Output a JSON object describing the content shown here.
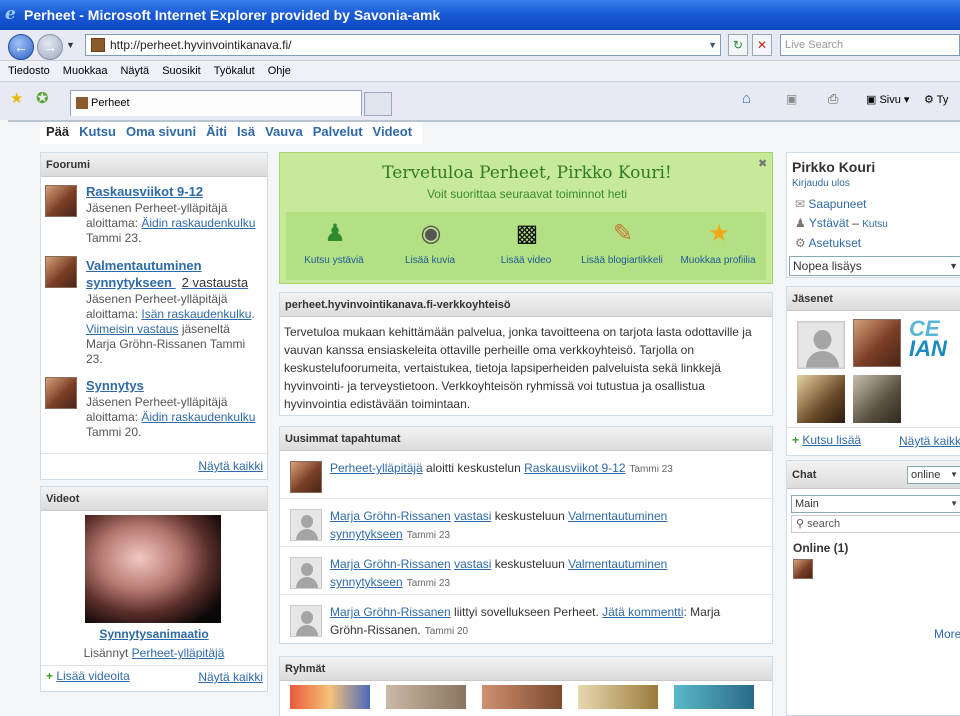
{
  "window": {
    "title": "Perheet - Microsoft Internet Explorer provided by Savonia-amk",
    "address": "http://perheet.hyvinvointikanava.fi/",
    "search_placeholder": "Live Search",
    "menu": [
      "Tiedosto",
      "Muokkaa",
      "Näytä",
      "Suosikit",
      "Työkalut",
      "Ohje"
    ],
    "tab_title": "Perheet",
    "sivu_label": "Sivu",
    "tyo_label": "Ty"
  },
  "nav": [
    "Pää",
    "Kutsu",
    "Oma sivuni",
    "Äiti",
    "Isä",
    "Vauva",
    "Palvelut",
    "Videot"
  ],
  "forum": {
    "heading": "Foorumi",
    "items": [
      {
        "title": "Raskausviikot 9-12",
        "line1": "Jäsenen Perheet-ylläpitäjä",
        "starter_prefix": "aloittama: ",
        "starter_link": "Äidin raskaudenkulku",
        "date": "Tammi 23."
      },
      {
        "title": "Valmentautuminen synnytykseen",
        "title_1": "Valmentautuminen",
        "title_2": "synnytykseen",
        "reply_count": "2 vastausta",
        "line1": "Jäsenen Perheet-ylläpitäjä",
        "starter_prefix": "aloittama: ",
        "starter_link": "Isän raskaudenkulku",
        "latest_link": "Viimeisin vastaus",
        "latest_suffix": " jäseneltä",
        "latest_name": "Marja Gröhn-Rissanen Tammi",
        "date": "23."
      },
      {
        "title": "Synnytys",
        "line1": "Jäsenen Perheet-ylläpitäjä",
        "starter_prefix": "aloittama: ",
        "starter_link": "Äidin raskaudenkulku",
        "date": "Tammi 20."
      }
    ],
    "show_all": "Näytä kaikki"
  },
  "videos": {
    "heading": "Videot",
    "title": "Synnytysanimaatio",
    "added_prefix": "Lisännyt ",
    "added_by": "Perheet-ylläpitäjä",
    "add": "Lisää videoita",
    "show_all": "Näytä kaikki"
  },
  "welcome": {
    "title": "Tervetuloa Perheet, Pirkko Kouri!",
    "subtitle": "Voit suorittaa seuraavat toiminnot heti",
    "actions": [
      {
        "label": "Kutsu ystäviä",
        "icon": "add-user-icon"
      },
      {
        "label": "Lisää kuvia",
        "icon": "camera-icon"
      },
      {
        "label": "Lisää video",
        "icon": "clapperboard-icon"
      },
      {
        "label": "Lisää blogiartikkeli",
        "icon": "notepad-icon"
      },
      {
        "label": "Muokkaa profiilia",
        "icon": "star-icon"
      }
    ]
  },
  "about": {
    "heading": "perheet.hyvinvointikanava.fi-verkkoyhteisö",
    "lines": [
      "Tervetuloa mukaan kehittämään palvelua, jonka tavoitteena on tarjota lasta odottaville ja",
      "vauvan kanssa ensiaskeleita ottaville perheille oma verkkoyhteisö. Tarjolla on",
      "keskustelufoorumeita, vertaistukea, tietoja lapsiperheiden palveluista sekä linkkejä",
      "hyvinvointi- ja terveystietoon. Verkkoyhteisön ryhmissä voi tutustua ja osallistua",
      "hyvinvointia edistävään toimintaan."
    ]
  },
  "events": {
    "heading": "Uusimmat tapahtumat",
    "items": [
      {
        "actor": "Perheet-ylläpitäjä",
        "verb": " aloitti keskustelun ",
        "target": "Raskausviikot 9-12",
        "date": "Tammi 23"
      },
      {
        "actor": "Marja Gröhn-Rissanen",
        "action_link": "vastasi",
        "verb": " keskusteluun ",
        "target_1": "Valmentautuminen",
        "target_2": "synnytykseen",
        "date": "Tammi 23"
      },
      {
        "actor": "Marja Gröhn-Rissanen",
        "action_link": "vastasi",
        "verb": " keskusteluun ",
        "target_1": "Valmentautuminen",
        "target_2": "synnytykseen",
        "date": "Tammi 23"
      },
      {
        "actor": "Marja Gröhn-Rissanen",
        "verb": " liittyi sovellukseen Perheet. ",
        "comment_link": "Jätä kommentti",
        "tail": ": Marja",
        "tail_2": "Gröhn-Rissanen.",
        "date": "Tammi 20"
      }
    ]
  },
  "groups": {
    "heading": "Ryhmät"
  },
  "profile": {
    "name": "Pirkko Kouri",
    "logout": "Kirjaudu ulos",
    "inbox": "Saapuneet",
    "friends": "Ystävät",
    "friends_sep": " – ",
    "invite": "Kutsu",
    "settings": "Asetukset",
    "quick_add": "Nopea lisäys"
  },
  "members": {
    "heading": "Jäsenet",
    "logo_text": "CE",
    "logo_text_2": "IAN",
    "invite_more": "Kutsu lisää",
    "show_all": "Näytä kaikki"
  },
  "chat": {
    "heading": "Chat",
    "status": "online",
    "room": "Main",
    "search": "search",
    "online": "Online (1)",
    "more": "More"
  },
  "colors": {
    "accent": "#2f6aa8",
    "welcome_bg": "#c6ea9a",
    "welcome_title": "#2f7a27"
  }
}
